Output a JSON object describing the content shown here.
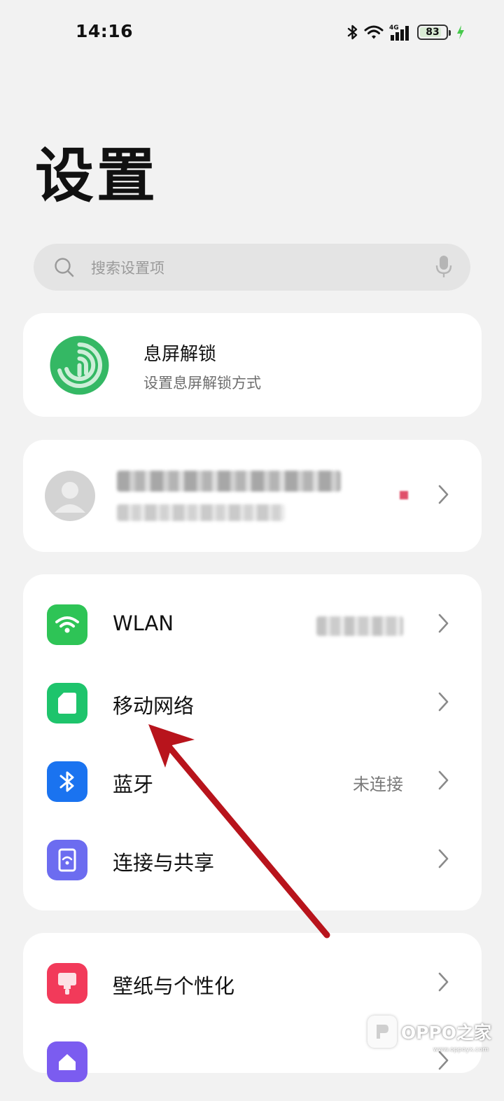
{
  "status": {
    "time": "14:16",
    "network": "4G",
    "battery": "83",
    "battery_fraction": 0.83
  },
  "page": {
    "title": "设置"
  },
  "search": {
    "placeholder": "搜索设置项"
  },
  "lockscreen": {
    "title": "息屏解锁",
    "subtitle": "设置息屏解锁方式"
  },
  "network_section": {
    "items": [
      {
        "label": "WLAN"
      },
      {
        "label": "移动网络"
      },
      {
        "label": "蓝牙",
        "value": "未连接"
      },
      {
        "label": "连接与共享"
      }
    ]
  },
  "personal_section": {
    "items": [
      {
        "label": "壁纸与个性化"
      }
    ]
  },
  "watermark": {
    "brand": "OPPO之家",
    "url": "www.oppoyx.com"
  },
  "colors": {
    "background": "#f2f2f2",
    "card": "#ffffff",
    "wlan_icon": "#2ec456",
    "mobile_icon": "#1ec46c",
    "bluetooth_icon": "#1a73f0",
    "share_icon": "#6c6cf0",
    "wallpaper_icon": "#f23a5a",
    "annotation_arrow": "#b8141c",
    "charging_bolt": "#45c94a"
  }
}
